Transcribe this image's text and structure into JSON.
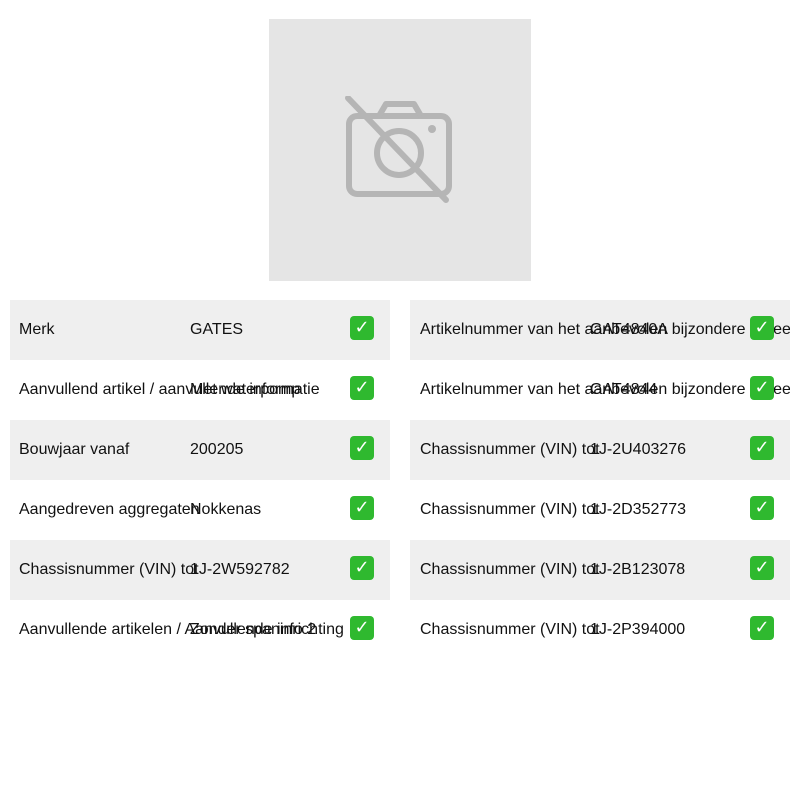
{
  "image": {
    "icon": "camera-off-icon"
  },
  "check_glyph": "✓",
  "left_rows": [
    {
      "label": "Merk",
      "value": "GATES"
    },
    {
      "label": "Aanvullend artikel / aanvullende informatie",
      "value": "Met waterpomp"
    },
    {
      "label": "Bouwjaar vanaf",
      "value": "200205"
    },
    {
      "label": "Aangedreven aggregaten",
      "value": "Nokkenas"
    },
    {
      "label": "Chassisnummer (VIN) tot",
      "value": "1J-2W592782"
    },
    {
      "label": "Aanvullende artikelen / Aanvullende info 2",
      "value": "Zonder spaninrichting"
    }
  ],
  "right_rows": [
    {
      "label": "Artikelnummer van het aanbevolen bijzondere gereedschap",
      "value": "GAT4840A"
    },
    {
      "label": "Artikelnummer van het aanbevolen bijzondere gereedschap",
      "value": "GAT4844"
    },
    {
      "label": "Chassisnummer (VIN) tot",
      "value": "1J-2U403276"
    },
    {
      "label": "Chassisnummer (VIN) tot",
      "value": "1J-2D352773"
    },
    {
      "label": "Chassisnummer (VIN) tot",
      "value": "1J-2B123078"
    },
    {
      "label": "Chassisnummer (VIN) tot",
      "value": "1J-2P394000"
    }
  ]
}
